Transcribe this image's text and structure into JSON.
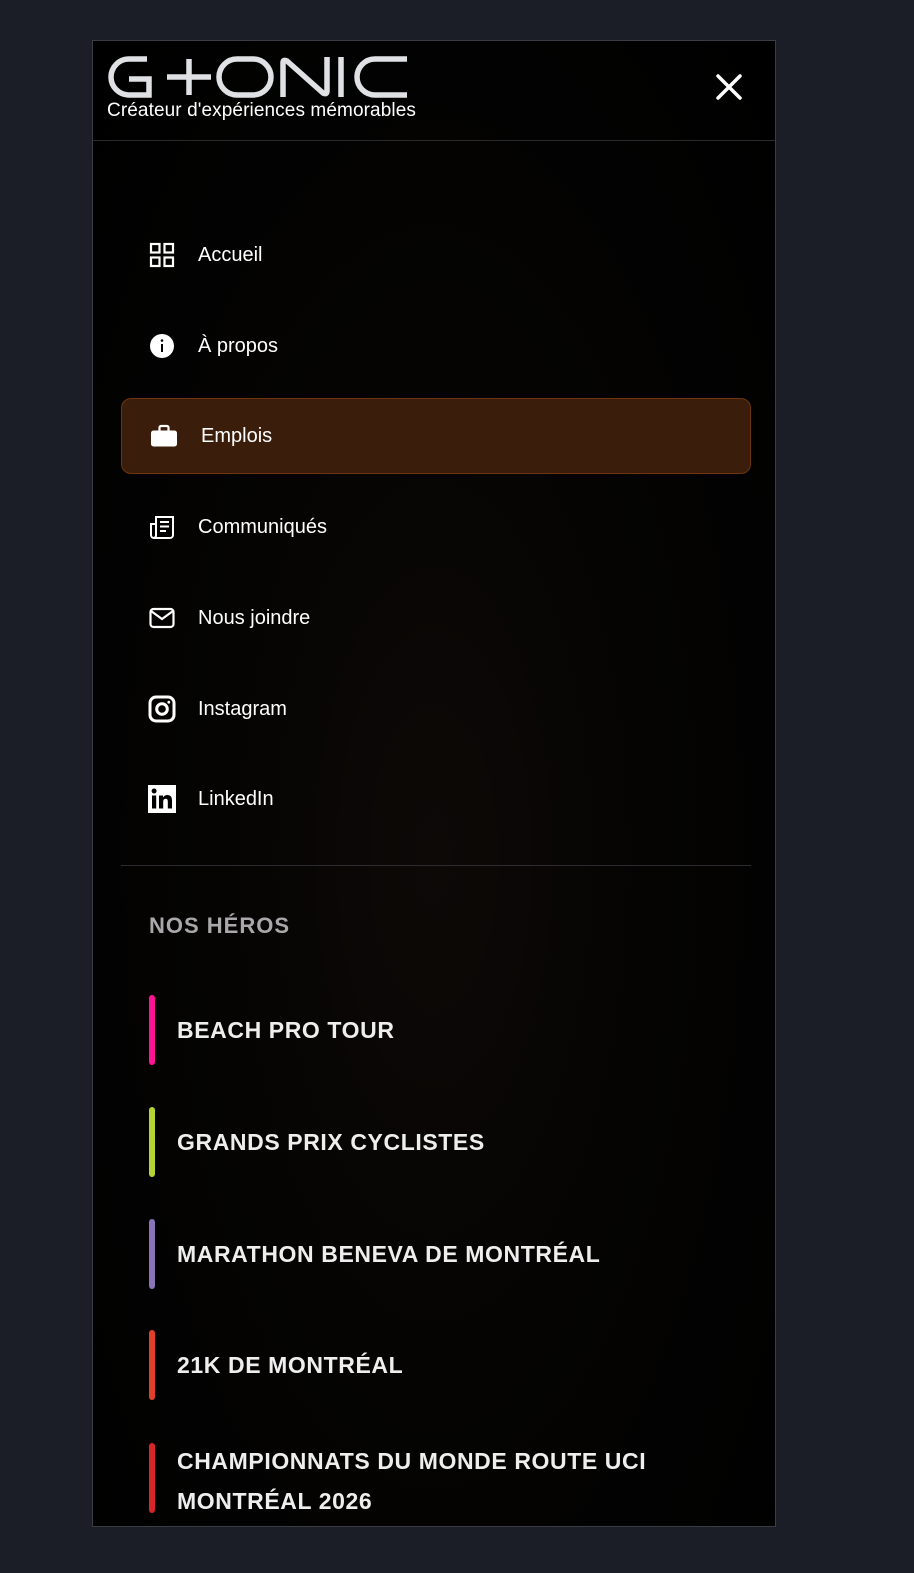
{
  "brand": {
    "logo_text": "G+ONIC",
    "tagline": "Créateur d'expériences mémorables"
  },
  "header": {
    "close_icon": "close-icon"
  },
  "nav": {
    "items": [
      {
        "label": "Accueil",
        "icon": "grid-icon"
      },
      {
        "label": "À propos",
        "icon": "info-icon"
      },
      {
        "label": "Emplois",
        "icon": "briefcase-icon",
        "active": true
      },
      {
        "label": "Communiqués",
        "icon": "newspaper-icon"
      },
      {
        "label": "Nous joindre",
        "icon": "mail-icon"
      },
      {
        "label": "Instagram",
        "icon": "instagram-icon"
      },
      {
        "label": "LinkedIn",
        "icon": "linkedin-icon"
      }
    ]
  },
  "heroes": {
    "title": "NOS HÉROS",
    "items": [
      {
        "label": "BEACH PRO TOUR",
        "color": "#ff1493"
      },
      {
        "label": "GRANDS PRIX CYCLISTES",
        "color": "#b5d334"
      },
      {
        "label": "MARATHON BENEVA DE MONTRÉAL",
        "color": "#8a74b8"
      },
      {
        "label": "21K DE MONTRÉAL",
        "color": "#e0402a"
      },
      {
        "label": "CHAMPIONNATS DU MONDE ROUTE UCI MONTRÉAL 2026",
        "color": "#d6262a"
      }
    ]
  },
  "colors": {
    "page_background": "#1b1e27",
    "panel_background": "#000000",
    "active_item_background": "#3a1d0a",
    "active_item_border": "#6e3412"
  }
}
